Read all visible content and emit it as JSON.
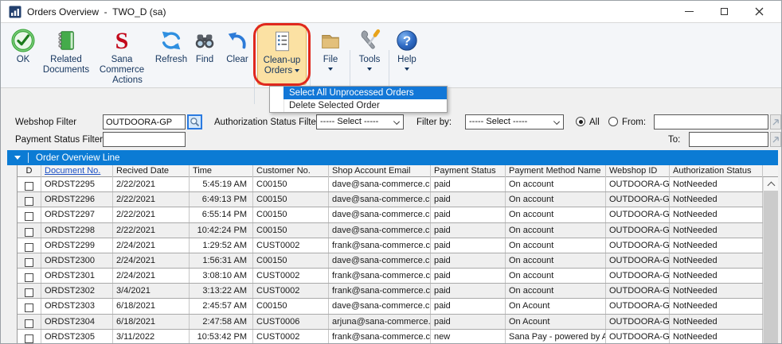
{
  "window": {
    "title": "Orders Overview  -  TWO_D (sa)"
  },
  "toolbar": {
    "buttons": [
      {
        "label": "OK",
        "icon": "ok-check-icon"
      },
      {
        "label": "Related Documents",
        "icon": "green-book-icon"
      },
      {
        "label": "Sana Commerce",
        "icon": "sana-s-icon"
      },
      {
        "label": "Refresh",
        "icon": "refresh-arrows-icon"
      },
      {
        "label": "Find",
        "icon": "binoculars-icon"
      },
      {
        "label": "Clear",
        "icon": "undo-arrow-icon"
      },
      {
        "label": "Clean-up Orders",
        "icon": "list-page-icon",
        "dropdown": true,
        "highlighted": true
      },
      {
        "label": "File",
        "icon": "folder-icon",
        "dropdown": true
      },
      {
        "label": "Tools",
        "icon": "tools-icon",
        "dropdown": true
      },
      {
        "label": "Help",
        "icon": "help-question-icon",
        "dropdown": true
      }
    ],
    "group_label": "Actions"
  },
  "menu": {
    "items": [
      {
        "label": "Select All Unprocessed Orders",
        "selected": true
      },
      {
        "label": "Delete Selected Order",
        "selected": false
      }
    ]
  },
  "filters": {
    "webshop": {
      "label": "Webshop Filter",
      "value": "OUTDOORA-GP"
    },
    "payment_status": {
      "label": "Payment Status Filter",
      "value": ""
    },
    "authorization": {
      "label": "Authorization Status Filter",
      "value": "----- Select -----"
    },
    "filter_by": {
      "label": "Filter by:",
      "value": "----- Select -----"
    },
    "range": {
      "all_label": "All",
      "from_label": "From:",
      "to_label": "To:",
      "all_selected": true,
      "from_value": "",
      "to_value": ""
    }
  },
  "table": {
    "title": "Order Overview Line",
    "columns": [
      "D",
      "Document No.",
      "Recived Date",
      "Time",
      "Customer No.",
      "Shop Account Email",
      "Payment Status",
      "Payment Method Name",
      "Webshop ID",
      "Authorization Status"
    ],
    "rows": [
      [
        "ORDST2295",
        "2/22/2021",
        "5:45:19 AM",
        "C00150",
        "dave@sana-commerce.c",
        "paid",
        "On account",
        "OUTDOORA-G",
        "NotNeeded"
      ],
      [
        "ORDST2296",
        "2/22/2021",
        "6:49:13 PM",
        "C00150",
        "dave@sana-commerce.c",
        "paid",
        "On account",
        "OUTDOORA-G",
        "NotNeeded"
      ],
      [
        "ORDST2297",
        "2/22/2021",
        "6:55:14 PM",
        "C00150",
        "dave@sana-commerce.c",
        "paid",
        "On account",
        "OUTDOORA-G",
        "NotNeeded"
      ],
      [
        "ORDST2298",
        "2/22/2021",
        "10:42:24 PM",
        "C00150",
        "dave@sana-commerce.c",
        "paid",
        "On account",
        "OUTDOORA-G",
        "NotNeeded"
      ],
      [
        "ORDST2299",
        "2/24/2021",
        "1:29:52 AM",
        "CUST0002",
        "frank@sana-commerce.c",
        "paid",
        "On account",
        "OUTDOORA-G",
        "NotNeeded"
      ],
      [
        "ORDST2300",
        "2/24/2021",
        "1:56:31 AM",
        "C00150",
        "dave@sana-commerce.c",
        "paid",
        "On account",
        "OUTDOORA-G",
        "NotNeeded"
      ],
      [
        "ORDST2301",
        "2/24/2021",
        "3:08:10 AM",
        "CUST0002",
        "frank@sana-commerce.c",
        "paid",
        "On account",
        "OUTDOORA-G",
        "NotNeeded"
      ],
      [
        "ORDST2302",
        "3/4/2021",
        "3:13:22 AM",
        "CUST0002",
        "frank@sana-commerce.c",
        "paid",
        "On account",
        "OUTDOORA-G",
        "NotNeeded"
      ],
      [
        "ORDST2303",
        "6/18/2021",
        "2:45:57 AM",
        "C00150",
        "dave@sana-commerce.c",
        "paid",
        "On Acount",
        "OUTDOORA-G",
        "NotNeeded"
      ],
      [
        "ORDST2304",
        "6/18/2021",
        "2:47:58 AM",
        "CUST0006",
        "arjuna@sana-commerce.",
        "paid",
        "On Acount",
        "OUTDOORA-G",
        "NotNeeded"
      ],
      [
        "ORDST2305",
        "3/11/2022",
        "10:53:42 PM",
        "CUST0002",
        "frank@sana-commerce.c",
        "new",
        "Sana Pay - powered by A",
        "OUTDOORA-G",
        "NotNeeded"
      ]
    ]
  },
  "colors": {
    "accent_blue": "#0b7bd4",
    "menu_highlight": "#1277d7",
    "annotation_red": "#e0281e",
    "button_highlight": "#fbe1a3",
    "link_blue": "#1d50c4"
  }
}
